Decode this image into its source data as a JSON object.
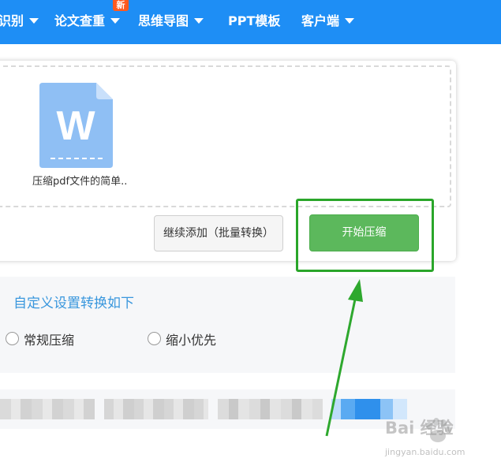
{
  "nav": {
    "items": [
      {
        "label": "识别"
      },
      {
        "label": "论文查重"
      },
      {
        "label": "思维导图"
      },
      {
        "label": "PPT模板"
      },
      {
        "label": "客户端"
      }
    ],
    "new_badge": "新"
  },
  "upload": {
    "file_name": "压缩pdf文件的简单..",
    "file_icon_letter": "W",
    "continue_button": "继续添加（批量转换）",
    "start_button": "开始压缩"
  },
  "settings": {
    "title": "自定义设置转换如下",
    "options": [
      {
        "label": "常规压缩"
      },
      {
        "label": "缩小优先"
      }
    ]
  },
  "watermark": {
    "brand": "Bai 经验",
    "url": "jingyan.baidu.com"
  },
  "colors": {
    "nav_bg": "#1e8ef5",
    "start_button": "#5cb85c",
    "highlight": "#2aa62a",
    "settings_title": "#3a97dd"
  }
}
